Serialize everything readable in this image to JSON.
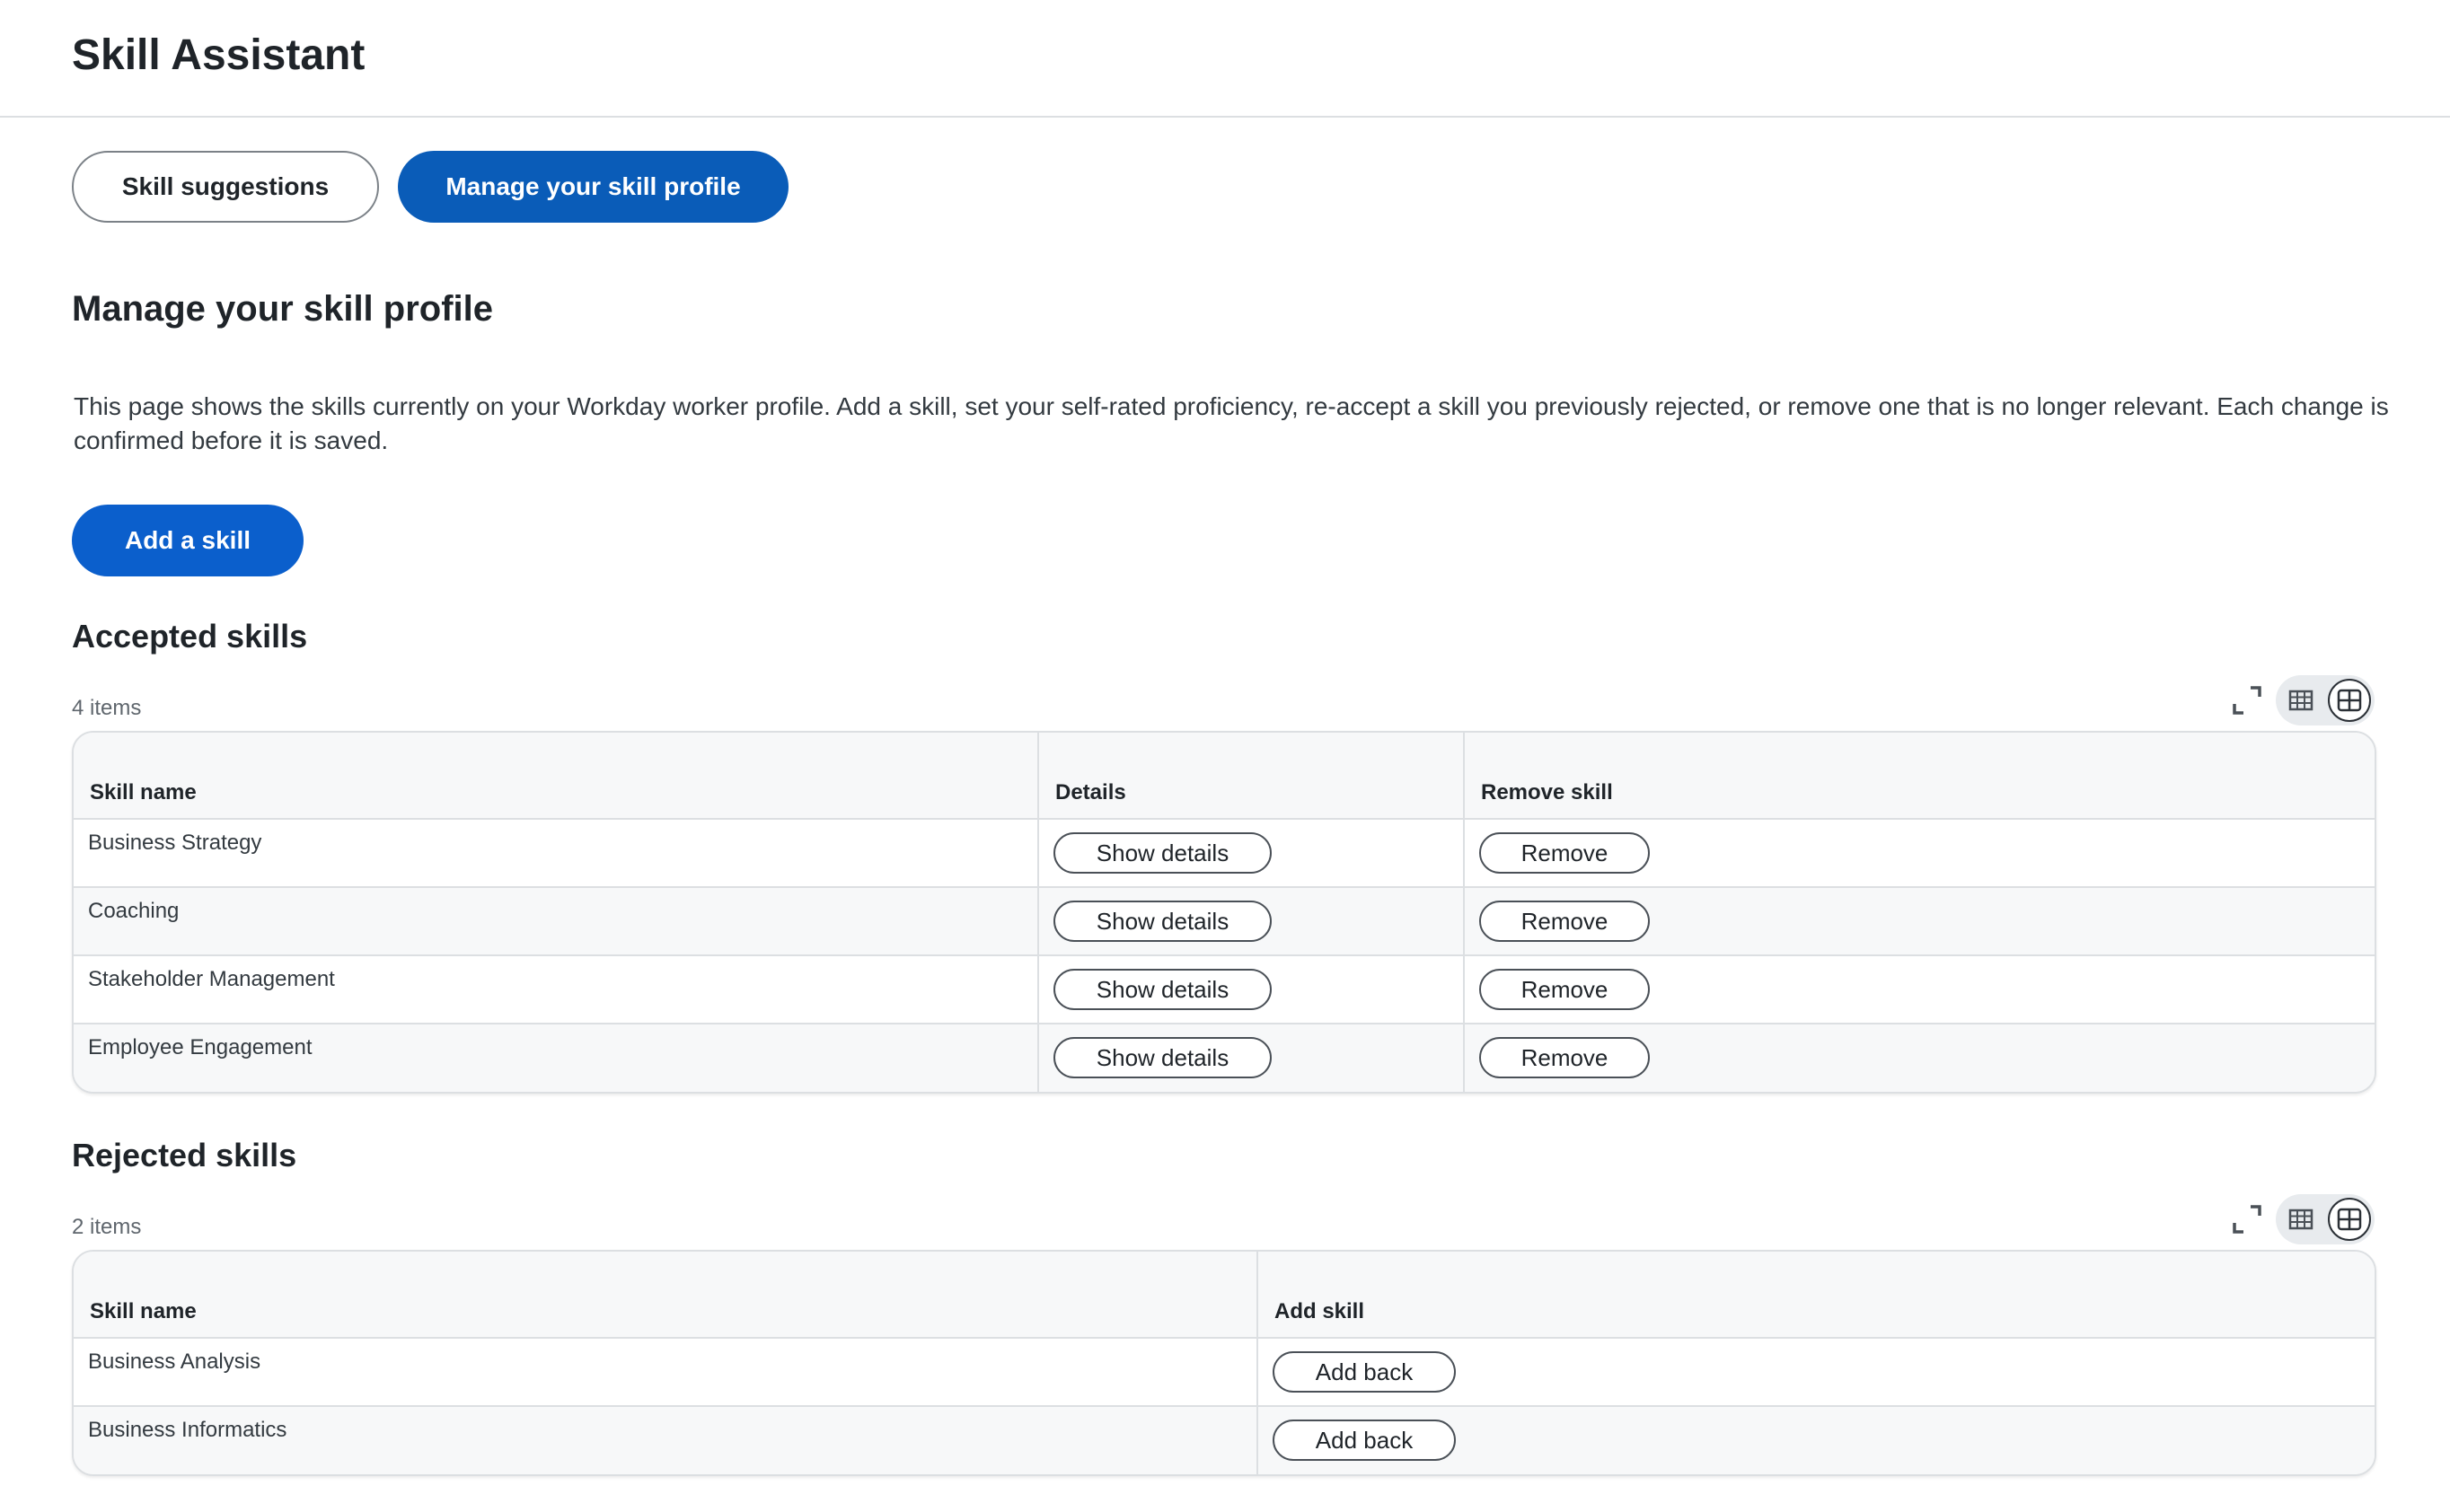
{
  "app": {
    "title": "Skill Assistant"
  },
  "tabs": [
    {
      "label": "Skill suggestions",
      "active": false
    },
    {
      "label": "Manage your skill profile",
      "active": true
    }
  ],
  "main": {
    "title": "Manage your skill profile",
    "description": "This page shows the skills currently on your Workday worker profile. Add a skill, set your self-rated proficiency, re-accept a skill you previously rejected, or remove one that is no longer relevant. Each change is confirmed before it is saved.",
    "add_skill_label": "Add a skill"
  },
  "accepted": {
    "title": "Accepted skills",
    "count": "4 items",
    "columns": [
      "Skill name",
      "Details",
      "Remove skill"
    ],
    "details_label": "Show details",
    "remove_label": "Remove",
    "rows": [
      {
        "skill": "Business Strategy"
      },
      {
        "skill": "Coaching"
      },
      {
        "skill": "Stakeholder Management"
      },
      {
        "skill": "Employee Engagement"
      }
    ]
  },
  "rejected": {
    "title": "Rejected skills",
    "count": "2 items",
    "columns": [
      "Skill name",
      "Add skill"
    ],
    "add_back_label": "Add back",
    "rows": [
      {
        "skill": "Business Analysis"
      },
      {
        "skill": "Business Informatics"
      }
    ]
  },
  "icons": {
    "expand": "expand-icon",
    "table_view": "table-view-icon",
    "grid_view": "grid-view-icon"
  },
  "colors": {
    "primary": "#0a5cb8",
    "primary_button": "#0b5fcc",
    "border": "#dcdfe2",
    "header_bg": "#f7f8f9"
  }
}
